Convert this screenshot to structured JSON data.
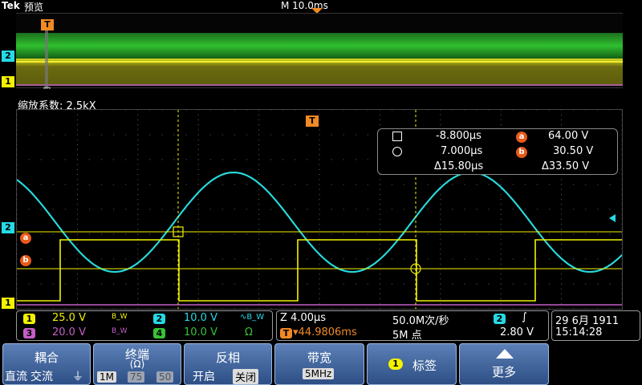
{
  "header": {
    "brand": "Tek",
    "mode": "预览",
    "timebase": "M 10.0ms",
    "trigger_marker": "T"
  },
  "overview": {
    "zoom_factor": "缩放系数: 2.5kX",
    "ch2_marker": "2",
    "ch1_marker": "1"
  },
  "cursor_readout": {
    "a_time": "-8.800μs",
    "b_time": "7.000μs",
    "delta_time": "Δ15.80μs",
    "a_label": "a",
    "b_label": "b",
    "a_volt": "64.00 V",
    "b_volt": "30.50 V",
    "delta_volt": "Δ33.50 V"
  },
  "waveform_markers": {
    "ch2": "2",
    "ch1": "1",
    "a": "a",
    "b": "b",
    "trigger": "T"
  },
  "channels": [
    {
      "num": "1",
      "scale": "25.0 V",
      "bw": "B_W",
      "color": "#f2f200"
    },
    {
      "num": "2",
      "scale": "10.0 V",
      "bw": "∿B_W",
      "color": "#26d9e6"
    },
    {
      "num": "3",
      "scale": "20.0 V",
      "bw": "B_W",
      "color": "#c45ec8"
    },
    {
      "num": "4",
      "scale": "10.0 V",
      "bw": "Ω",
      "color": "#36c436"
    }
  ],
  "horizontal": {
    "zoom": "Z 4.00μs",
    "sample_rate": "50.0M次/秒",
    "position": "▾44.9806ms",
    "record": "5M 点"
  },
  "trigger": {
    "source": "2",
    "slope": "∫",
    "level": "2.80 V"
  },
  "datetime": {
    "date": "29 6月  1911",
    "time": "15:14:28"
  },
  "menu": {
    "coupling": {
      "title": "耦合",
      "opt1": "直流",
      "opt2": "交流",
      "icon": "⏚"
    },
    "termination": {
      "title": "终端",
      "sub": "(Ω)",
      "opt1": "1M",
      "opt2": "75",
      "opt3": "50"
    },
    "invert": {
      "title": "反相",
      "opt1": "开启",
      "opt2": "关闭"
    },
    "bandwidth": {
      "title": "带宽",
      "value": "5MHz"
    },
    "label": {
      "badge": "1",
      "title": "标签"
    },
    "more": {
      "title": "更多"
    }
  },
  "colors": {
    "ch1": "#f2f200",
    "ch2": "#26d9e6",
    "ch3": "#c45ec8",
    "ch4": "#36c436",
    "trigger": "#f08a24",
    "menu_blue": "#3f64a0"
  }
}
